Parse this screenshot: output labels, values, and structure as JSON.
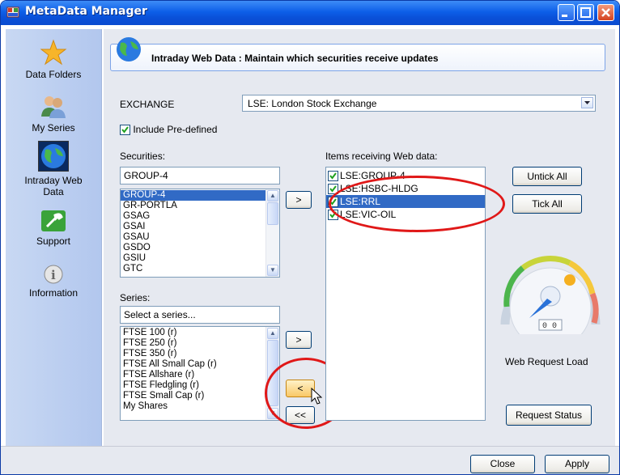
{
  "window": {
    "title": "MetaData Manager"
  },
  "sidebar": {
    "items": [
      {
        "label": "Data Folders",
        "icon": "star-icon"
      },
      {
        "label": "My Series",
        "icon": "users-icon"
      },
      {
        "label": "Intraday Web Data",
        "icon": "globe-icon"
      },
      {
        "label": "Support",
        "icon": "wrench-icon"
      },
      {
        "label": "Information",
        "icon": "info-icon"
      }
    ]
  },
  "header": {
    "title": "Intraday Web Data : Maintain which securities receive updates"
  },
  "exchange": {
    "label": "EXCHANGE",
    "value": "LSE: London Stock Exchange"
  },
  "include_predefined": {
    "label": "Include Pre-defined",
    "checked": true
  },
  "securities": {
    "label": "Securities:",
    "filter_value": "GROUP-4",
    "items": [
      "GROUP-4",
      "GR-PORTLA",
      "GSAG",
      "GSAI",
      "GSAU",
      "GSDO",
      "GSIU",
      "GTC"
    ],
    "selected": "GROUP-4"
  },
  "series": {
    "label": "Series:",
    "placeholder": "Select a series...",
    "items": [
      "FTSE 100 (r)",
      "FTSE 250 (r)",
      "FTSE 350 (r)",
      "FTSE All Small Cap (r)",
      "FTSE Allshare (r)",
      "FTSE Fledgling (r)",
      "FTSE Small Cap (r)",
      "My Shares"
    ]
  },
  "transfer": {
    "add_security": ">",
    "add_series": ">",
    "remove": "<",
    "remove_all": "<<"
  },
  "web_items": {
    "label": "Items receiving Web data:",
    "items": [
      {
        "text": "LSE:GROUP-4",
        "checked": true
      },
      {
        "text": "LSE:HSBC-HLDG",
        "checked": true
      },
      {
        "text": "LSE:RRL",
        "checked": true,
        "selected": true
      },
      {
        "text": "LSE:VIC-OIL",
        "checked": true
      }
    ]
  },
  "buttons": {
    "untick_all": "Untick All",
    "tick_all": "Tick All",
    "request_status": "Request Status",
    "close": "Close",
    "apply": "Apply"
  },
  "gauge": {
    "label": "Web Request Load",
    "readout": "0 0",
    "level": 0.0
  },
  "colors": {
    "titlebar": "#0a50d8",
    "selection": "#316ac5",
    "highlight_oval": "#e01818"
  }
}
